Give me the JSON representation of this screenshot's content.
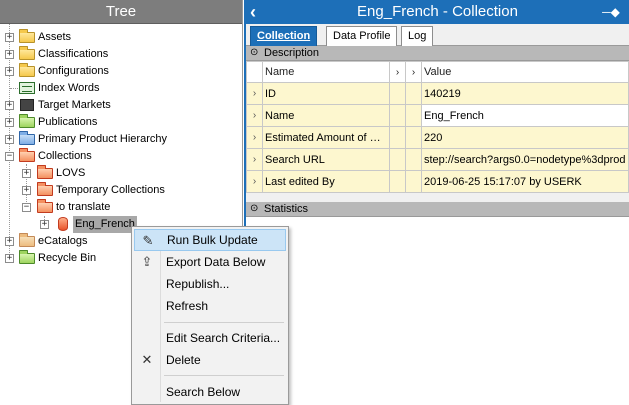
{
  "tree": {
    "title": "Tree",
    "items": [
      {
        "label": "Assets",
        "icon": "folder-icon"
      },
      {
        "label": "Classifications",
        "icon": "folder-icon"
      },
      {
        "label": "Configurations",
        "icon": "folder-icon"
      },
      {
        "label": "Index Words",
        "icon": "index-words-icon"
      },
      {
        "label": "Target Markets",
        "icon": "target-markets-icon"
      },
      {
        "label": "Publications",
        "icon": "publications-folder-icon"
      },
      {
        "label": "Primary Product Hierarchy",
        "icon": "hierarchy-folder-icon"
      },
      {
        "label": "Collections",
        "icon": "collections-icon"
      },
      {
        "label": "LOVS",
        "icon": "collection-folder-icon"
      },
      {
        "label": "Temporary Collections",
        "icon": "collection-folder-icon"
      },
      {
        "label": "to translate",
        "icon": "collection-folder-icon"
      },
      {
        "label": "Eng_French",
        "icon": "collection-icon"
      },
      {
        "label": "eCatalogs",
        "icon": "ecatalogs-icon"
      },
      {
        "label": "Recycle Bin",
        "icon": "recycle-bin-icon"
      }
    ]
  },
  "detail": {
    "title": "Eng_French - Collection",
    "tabs": [
      "Collection",
      "Data Profile",
      "Log"
    ],
    "sections": {
      "description": "Description",
      "statistics": "Statistics"
    },
    "columns": {
      "name": "Name",
      "value": "Value"
    },
    "rows": [
      {
        "name": "ID",
        "value": "140219"
      },
      {
        "name": "Name",
        "value": "Eng_French"
      },
      {
        "name": "Estimated Amount of Obje...",
        "value": "220"
      },
      {
        "name": "Search URL",
        "value": "step://search?args0.0=nodetype%3dprod"
      },
      {
        "name": "Last edited By",
        "value": "2019-06-25 15:17:07 by USERK"
      }
    ]
  },
  "context_menu": {
    "items": [
      {
        "label": "Run Bulk Update",
        "icon": "bulk-update-icon"
      },
      {
        "label": "Export Data Below",
        "icon": "export-icon"
      },
      {
        "label": "Republish...",
        "icon": ""
      },
      {
        "label": "Refresh",
        "icon": ""
      },
      {
        "label": "Edit Search Criteria...",
        "icon": ""
      },
      {
        "label": "Delete",
        "icon": "delete-x-icon"
      },
      {
        "label": "Search Below",
        "icon": ""
      }
    ]
  },
  "colors": {
    "accent": "#1d6fb8",
    "tree_header": "#7d7d7d",
    "row_highlight": "#fdf7cf",
    "menu_highlight": "#cce4f7"
  }
}
